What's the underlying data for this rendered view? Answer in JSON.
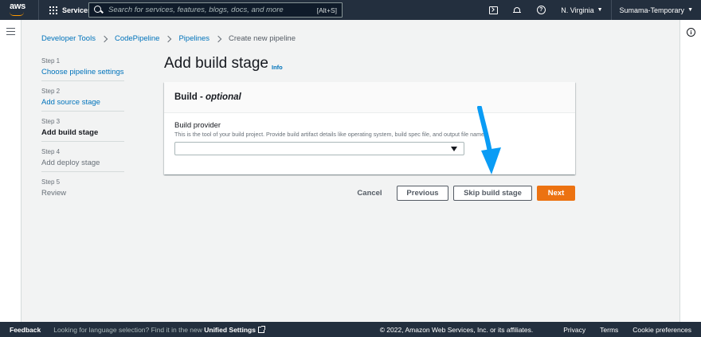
{
  "topnav": {
    "logo_text": "aws",
    "services_label": "Services",
    "search_placeholder": "Search for services, features, blogs, docs, and more",
    "search_shortcut": "[Alt+S]",
    "region": "N. Virginia",
    "account": "Sumama-Temporary"
  },
  "breadcrumb": {
    "items": [
      "Developer Tools",
      "CodePipeline",
      "Pipelines"
    ],
    "current": "Create new pipeline"
  },
  "steps": [
    {
      "num": "Step 1",
      "title": "Choose pipeline settings",
      "state": "link"
    },
    {
      "num": "Step 2",
      "title": "Add source stage",
      "state": "link"
    },
    {
      "num": "Step 3",
      "title": "Add build stage",
      "state": "current"
    },
    {
      "num": "Step 4",
      "title": "Add deploy stage",
      "state": "disabled"
    },
    {
      "num": "Step 5",
      "title": "Review",
      "state": "disabled"
    }
  ],
  "main": {
    "title": "Add build stage",
    "info_link": "Info",
    "panel": {
      "header_main": "Build - ",
      "header_optional": "optional",
      "field_label": "Build provider",
      "field_desc": "This is the tool of your build project. Provide build artifact details like operating system, build spec file, and output file names.",
      "select_value": ""
    },
    "actions": {
      "cancel": "Cancel",
      "previous": "Previous",
      "skip": "Skip build stage",
      "next": "Next"
    }
  },
  "footer": {
    "feedback": "Feedback",
    "lang_prefix": "Looking for language selection? Find it in the new ",
    "lang_link": "Unified Settings",
    "copyright": "© 2022, Amazon Web Services, Inc. or its affiliates.",
    "privacy": "Privacy",
    "terms": "Terms",
    "cookies": "Cookie preferences"
  },
  "colors": {
    "nav_bg": "#232f3e",
    "link": "#0073bb",
    "primary_button": "#ec7211",
    "annotation_arrow": "#0a9cf5"
  }
}
